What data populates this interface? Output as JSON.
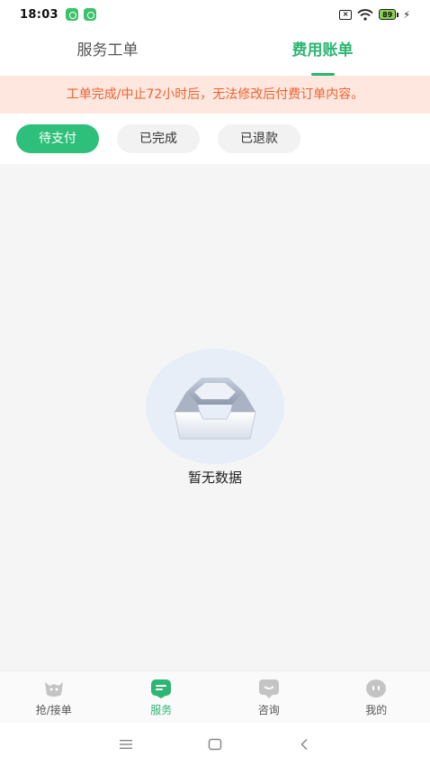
{
  "status_bar": {
    "time": "18:03",
    "battery": "89"
  },
  "top_tabs": [
    {
      "label": "服务工单",
      "active": false
    },
    {
      "label": "费用账单",
      "active": true
    }
  ],
  "notice": "工单完成/中止72小时后，无法修改后付费订单内容。",
  "filters": [
    {
      "label": "待支付",
      "active": true
    },
    {
      "label": "已完成",
      "active": false
    },
    {
      "label": "已退款",
      "active": false
    }
  ],
  "empty_state": {
    "icon": "empty-box-icon",
    "label": "暂无数据"
  },
  "bottom_nav": [
    {
      "label": "抢/接单",
      "icon": "grab-order-icon",
      "active": false
    },
    {
      "label": "服务",
      "icon": "service-icon",
      "active": true
    },
    {
      "label": "咨询",
      "icon": "consult-icon",
      "active": false
    },
    {
      "label": "我的",
      "icon": "profile-icon",
      "active": false
    }
  ],
  "colors": {
    "accent": "#2bb673",
    "notice_bg": "#fde7df",
    "notice_text": "#f0622e"
  }
}
